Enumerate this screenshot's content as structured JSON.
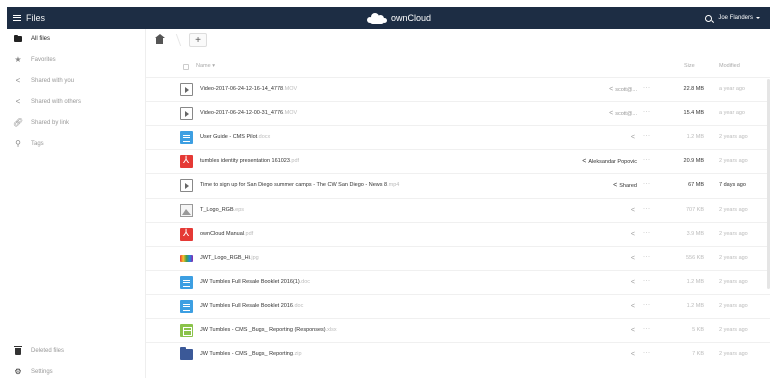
{
  "header": {
    "app_name": "Files",
    "brand": "ownCloud",
    "user": "Joe Flanders",
    "bg_color": "#1d2d44"
  },
  "sidebar": {
    "items": [
      {
        "label": "All files",
        "icon": "folder-icon",
        "active": true
      },
      {
        "label": "Favorites",
        "icon": "star-icon"
      },
      {
        "label": "Shared with you",
        "icon": "share-icon"
      },
      {
        "label": "Shared with others",
        "icon": "share-icon"
      },
      {
        "label": "Shared by link",
        "icon": "link-icon"
      },
      {
        "label": "Tags",
        "icon": "search-icon"
      }
    ],
    "bottom": [
      {
        "label": "Deleted files",
        "icon": "trash-icon"
      },
      {
        "label": "Settings",
        "icon": "gear-icon"
      }
    ]
  },
  "controls": {
    "add_label": "+"
  },
  "table": {
    "headers": {
      "name": "Name",
      "size": "Size",
      "modified": "Modified"
    },
    "rows": [
      {
        "name": "Video-2017-06-24-12-16-14_4778",
        "ext": ".MOV",
        "type": "video",
        "share": "scott@...",
        "size": "22.8 MB",
        "modified": "a year ago",
        "share_dark": false
      },
      {
        "name": "Video-2017-06-24-12-00-31_4776",
        "ext": ".MOV",
        "type": "video",
        "share": "scott@...",
        "size": "15.4 MB",
        "modified": "a year ago",
        "share_dark": false
      },
      {
        "name": "User Guide - CMS Pilot",
        "ext": ".docx",
        "type": "doc",
        "share": "",
        "size": "1.2 MB",
        "modified": "2 years ago",
        "share_dark": false
      },
      {
        "name": "tumbles identity presentation 161023",
        "ext": ".pdf",
        "type": "pdf",
        "share": "Aleksandar Popovic",
        "size": "20.9 MB",
        "modified": "2 years ago",
        "share_dark": true
      },
      {
        "name": "Time to sign up for San Diego summer camps - The CW San Diego - News 8",
        "ext": ".mp4",
        "type": "video",
        "share": "Shared",
        "size": "67 MB",
        "modified": "7 days ago",
        "share_dark": true
      },
      {
        "name": "T_Logo_RGB",
        "ext": ".eps",
        "type": "image",
        "share": "",
        "size": "707 KB",
        "modified": "2 years ago",
        "share_dark": false
      },
      {
        "name": "ownCloud Manual",
        "ext": ".pdf",
        "type": "pdf",
        "share": "",
        "size": "3.9 MB",
        "modified": "2 years ago",
        "share_dark": false
      },
      {
        "name": "JWT_Logo_RGB_Hi",
        "ext": ".jpg",
        "type": "logo",
        "share": "",
        "size": "556 KB",
        "modified": "2 years ago",
        "share_dark": false
      },
      {
        "name": "JW Tumbles Full Resale Booklet 2016(1)",
        "ext": ".doc",
        "type": "doc",
        "share": "",
        "size": "1.2 MB",
        "modified": "2 years ago",
        "share_dark": false
      },
      {
        "name": "JW Tumbles Full Resale Booklet 2016",
        "ext": ".doc",
        "type": "doc",
        "share": "",
        "size": "1.2 MB",
        "modified": "2 years ago",
        "share_dark": false
      },
      {
        "name": "JW Tumbles - CMS _Bugs_ Reporting (Responses)",
        "ext": ".xlsx",
        "type": "sheet",
        "share": "",
        "size": "5 KB",
        "modified": "2 years ago",
        "share_dark": false
      },
      {
        "name": "JW Tumbles - CMS _Bugs_ Reporting",
        "ext": ".zip",
        "type": "zip",
        "share": "",
        "size": "7 KB",
        "modified": "2 years ago",
        "share_dark": false
      }
    ]
  }
}
